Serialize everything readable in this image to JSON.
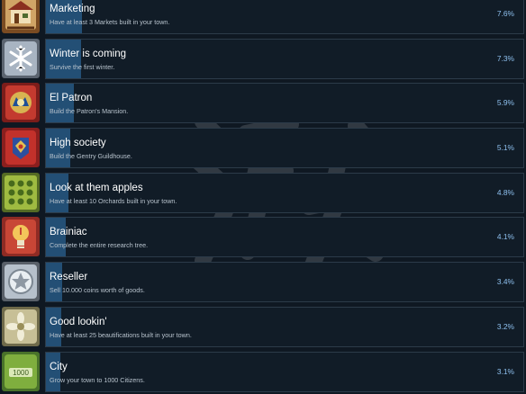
{
  "achievements": [
    {
      "title": "Marketing",
      "description": "Have at least 3 Markets built in your town.",
      "percent_label": "7.6%",
      "percent": 7.6,
      "icon": "market-badge-icon"
    },
    {
      "title": "Winter is coming",
      "description": "Survive the first winter.",
      "percent_label": "7.3%",
      "percent": 7.3,
      "icon": "snowflake-badge-icon"
    },
    {
      "title": "El Patron",
      "description": "Build the Patron's Mansion.",
      "percent_label": "5.9%",
      "percent": 5.9,
      "icon": "patron-crest-icon"
    },
    {
      "title": "High society",
      "description": "Build the Gentry Guildhouse.",
      "percent_label": "5.1%",
      "percent": 5.1,
      "icon": "gentry-crest-icon"
    },
    {
      "title": "Look at them apples",
      "description": "Have at least 10 Orchards built in your town.",
      "percent_label": "4.8%",
      "percent": 4.8,
      "icon": "orchard-grid-icon"
    },
    {
      "title": "Brainiac",
      "description": "Complete the entire research tree.",
      "percent_label": "4.1%",
      "percent": 4.1,
      "icon": "lightbulb-badge-icon"
    },
    {
      "title": "Reseller",
      "description": "Sell 10.000 coins worth of goods.",
      "percent_label": "3.4%",
      "percent": 3.4,
      "icon": "coin-star-icon"
    },
    {
      "title": "Good lookin'",
      "description": "Have at least 25 beautifications built in your town.",
      "percent_label": "3.2%",
      "percent": 3.2,
      "icon": "ornament-flower-icon"
    },
    {
      "title": "City",
      "description": "Grow your town to 1000 Citizens.",
      "percent_label": "3.1%",
      "percent": 3.1,
      "icon": "citizens-1000-icon",
      "icon_text": "1000"
    }
  ],
  "colors": {
    "background": "#0f1822",
    "row_fill": "#234f75",
    "percent_text": "#8ec0ef"
  }
}
